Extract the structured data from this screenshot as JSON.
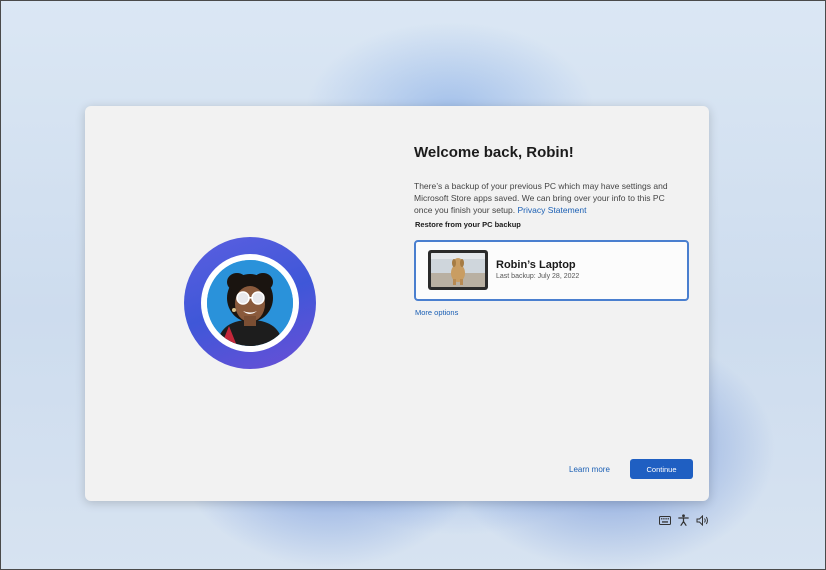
{
  "oobe": {
    "title": "Welcome back, Robin!",
    "description": "There’s a backup of your previous PC which may have settings and Microsoft Store apps saved. We can bring over your info to this PC once you finish your setup.",
    "privacy_link": "Privacy Statement",
    "restore_heading": "Restore from your PC backup",
    "backup": {
      "device_name": "Robin’s Laptop",
      "last_backup": "Last backup: July 28, 2022"
    },
    "more_options": "More options",
    "learn_more": "Learn more",
    "continue_label": "Continue"
  },
  "avatar": {
    "ring_colors": [
      "#5b5fe0",
      "#3f57d8",
      "#6a4fd6"
    ],
    "photo_bg": "#2a8fd6"
  },
  "tray": {
    "icons": [
      "keyboard-icon",
      "accessibility-icon",
      "volume-icon"
    ]
  },
  "colors": {
    "accent": "#1f5fc2",
    "link": "#1a5fb4",
    "card_bg": "#f2f2f2",
    "selected_border": "#4a7fcf"
  }
}
